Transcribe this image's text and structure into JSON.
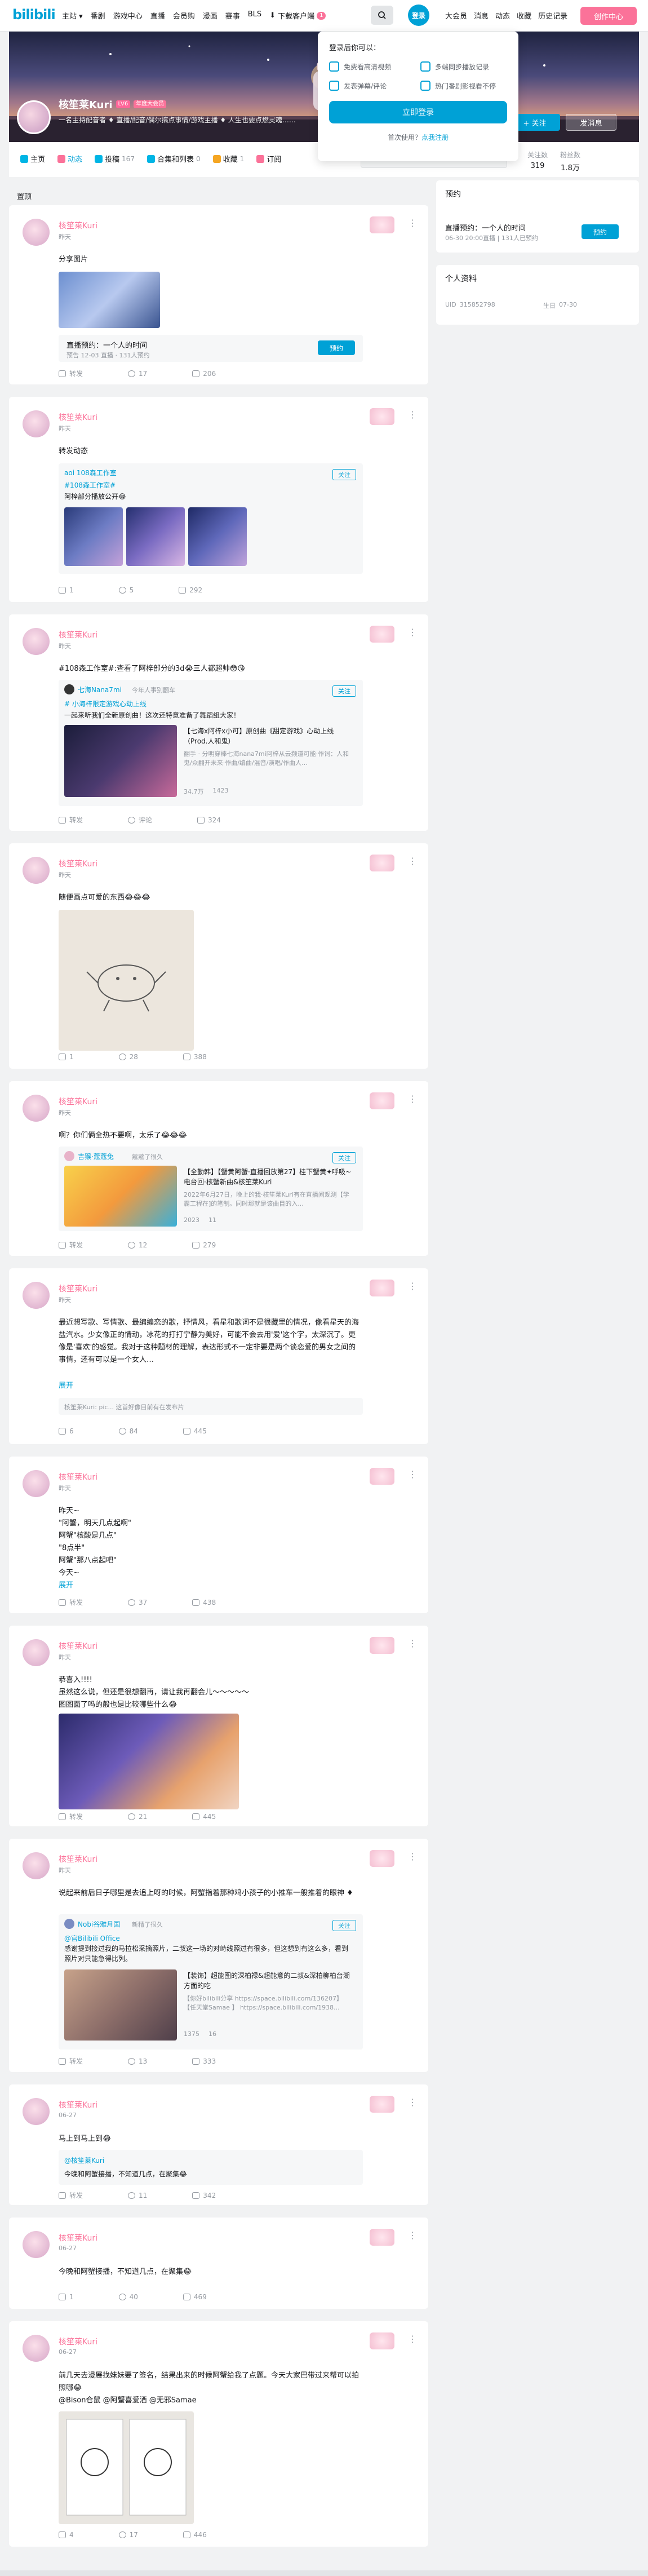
{
  "topnav": {
    "logo": "bilibili",
    "left_items": [
      "主站 ▾",
      "番剧",
      "游戏中心",
      "直播",
      "会员购",
      "漫画",
      "赛事",
      "BLS"
    ],
    "download": "下载客户端",
    "download_badge": "1",
    "login": "登录",
    "right_items": [
      "大会员",
      "消息",
      "动态",
      "收藏",
      "历史记录"
    ],
    "creator": "创作中心"
  },
  "login_popup": {
    "title": "登录后你可以：",
    "items": [
      "免费看高清视频",
      "多端同步播放记录",
      "发表弹幕/评论",
      "热门番剧影视看不停"
    ],
    "button": "立即登录",
    "foot": "首次使用？",
    "register": "点我注册"
  },
  "profile": {
    "name": "核笙莱Kuri",
    "level": "LV6",
    "vip": "年度大会员",
    "sign": "一名主持配音者 ♦ 直播/配音/偶尔搞点事情/游戏主播 ♦ 人生也要点燃灵魂……",
    "follow": "+ 关注",
    "message": "发消息"
  },
  "tabs": [
    {
      "label": "主页",
      "count": "",
      "color": "#00b5e5"
    },
    {
      "label": "动态",
      "count": "",
      "color": "#fb7299"
    },
    {
      "label": "投稿",
      "count": "167",
      "color": "#00b5e5"
    },
    {
      "label": "合集和列表",
      "count": "0",
      "color": "#00b5e5"
    },
    {
      "label": "收藏",
      "count": "1",
      "color": "#f5a623"
    },
    {
      "label": "订阅",
      "count": "",
      "color": "#fb7299"
    }
  ],
  "stats": [
    {
      "label": "关注数",
      "value": "319"
    },
    {
      "label": "粉丝数",
      "value": "1.8万"
    }
  ],
  "page_label": "置顶",
  "posts": [
    {
      "name": "核笙莱Kuri",
      "time": "昨天",
      "text": "分享图片",
      "share": "转发",
      "comment": "17",
      "like": "206",
      "inner_title": "直播预约：一个人的时间",
      "inner_sub": "预告 12-03 直播 · 131人预约",
      "inner_btn": "预约"
    },
    {
      "name": "核笙莱Kuri",
      "time": "昨天",
      "text": "转发动态",
      "share": "1",
      "comment": "5",
      "like": "292",
      "inner_user": "aoi 108森工作室",
      "inner_tag": "#108森工作室#",
      "inner_text": "阿梓部分播放公开😂",
      "inner_follow": "关注"
    },
    {
      "name": "核笙莱Kuri",
      "time": "昨天",
      "text": "#108森工作室#:查看了阿梓部分的3d😭三人都超帅😳😘",
      "share": "转发",
      "comment": "评论",
      "like": "324",
      "inner_user": "七海Nana7mi",
      "inner_user_sub": "今年人事别翻车",
      "inner_tag": "# 小海梓限定游戏心动上线",
      "inner_text": "一起来听我们全新原创曲！这次还特意准备了舞蹈组大家！",
      "video_title": "【七海x阿梓x小可】原创曲《甜定游戏》心动上线（Prod.人和鬼）",
      "video_sub": "翻手 · 分明穿棒七海nana7mi阿梓从云频道可能·作词：人和鬼/众翻开未来·作曲/编曲/混音/演唱/作曲人…",
      "video_views": "34.7万",
      "video_danmaku": "1423",
      "inner_follow": "关注"
    },
    {
      "name": "核笙莱Kuri",
      "time": "昨天",
      "text": "随便画点可爱的东西😂😂😂",
      "share": "1",
      "comment": "28",
      "like": "388"
    },
    {
      "name": "核笙莱Kuri",
      "time": "昨天",
      "text": "啊？你们俩全热不要啊，太乐了😂😂😂",
      "share": "转发",
      "comment": "12",
      "like": "279",
      "inner_user": "吉猴·蔻蔻兔",
      "inner_user_sub": "蔻蔻了很久",
      "video_title": "【全勤韩】【蟹黄阿蟹·直播回放第27】桂下蟹黄✦呼吸~电台回·核蟹新曲&核笙莱Kuri",
      "video_sub": "2022年6月27日，晚上的我·核笙莱Kuri有在直播间观测【学霸工程在]的笔制。同时那就是该曲目的入...",
      "video_views": "2023",
      "video_danmaku": "11",
      "inner_follow": "关注"
    },
    {
      "name": "核笙莱Kuri",
      "time": "昨天",
      "text": "最近想写歌、写情歌、最编编恋的歌，抒情风，看星和歌词不是很藏里的情况，像看星天的海盐汽水。少女像正的情动，冰花的打打宁静为美好，可能不会去用'爱'这个字，太深沉了。更像是'喜欢'的感觉。我对于这种题材的理解，表达形式不一定非要是两个谈恋爱的男女之间的事情，还有可以是一个女人…",
      "expand": "展开",
      "share": "6",
      "comment": "84",
      "like": "445",
      "inner_text": "核笙莱Kuri: pic... 这首好像目前有在发布片"
    },
    {
      "name": "核笙莱Kuri",
      "time": "昨天",
      "text": "昨天~\n\"阿蟹，明天几点起啊\"\n阿蟹\"核酸是几点\"\n\"8点半\"\n阿蟹\"那八点起吧\"\n今天~",
      "expand": "展开",
      "share": "转发",
      "comment": "37",
      "like": "438"
    },
    {
      "name": "核笙莱Kuri",
      "time": "昨天",
      "text": "恭喜入!!!!\n虽然这么说，但还是很想翻再，请让我再翻会儿～～～～～\n图图面了吗的般也是比较哪些什么😂",
      "share": "转发",
      "comment": "21",
      "like": "445"
    },
    {
      "name": "核笙莱Kuri",
      "time": "昨天",
      "text": "说起来前后日子哪里是去追上呀的时候，阿蟹指着那种鸡小孩子的小推车一般推着的眼神 ♦",
      "share": "转发",
      "comment": "13",
      "like": "333",
      "inner_user": "Nobi谷雅月国",
      "inner_user_sub": "新精了很久",
      "inner_tag": "@官Bilibili Office",
      "inner_text": "感谢提到接过我的马拉松采摘照片，二叔这一场的对峙线照过有很多，但这想到有这么多，看到照片对只能急得比列。",
      "video_title": "【装饰】超能图的深柏禄&超能意的二叔&深柏柳柏台湖方面的吃",
      "video_sub": "【你好bilibili分享 https://space.bilibili.com/136207】\n【任天堂Samae 】 https://space.bilibili.com/1938...",
      "video_views": "1375",
      "video_danmaku": "16",
      "inner_follow": "关注"
    },
    {
      "name": "核笙莱Kuri",
      "time": "06-27",
      "text": "马上到马上到😂",
      "share": "转发",
      "comment": "11",
      "like": "342",
      "inner_user": "@核笙莱Kuri",
      "inner_text": "今晚和阿蟹接播，不知道几点，在聚集😂"
    },
    {
      "name": "核笙莱Kuri",
      "time": "06-27",
      "text": "今晚和阿蟹接播，不知道几点，在聚集😂",
      "share": "1",
      "comment": "40",
      "like": "469"
    },
    {
      "name": "核笙莱Kuri",
      "time": "06-27",
      "text": "前几天去漫展找妹妹要了签名，结果出来的时候阿蟹给我了点题。今天大家巴带过来帮可以拍照哪😂",
      "mentions": "@Bison仓鼠 @阿蟹喜爱酒 @无邪Samae",
      "share": "4",
      "comment": "17",
      "like": "446"
    }
  ],
  "sidebar": {
    "reserve_title": "预约",
    "reserve_item": "直播预约：一个人的时间",
    "reserve_sub": "06-30 20:00直播 | 131人已预约",
    "reserve_btn": "预约",
    "profile_title": "个人资料",
    "uid_label": "UID",
    "uid": "315852798",
    "birth_label": "生日",
    "birth": "07-30"
  }
}
